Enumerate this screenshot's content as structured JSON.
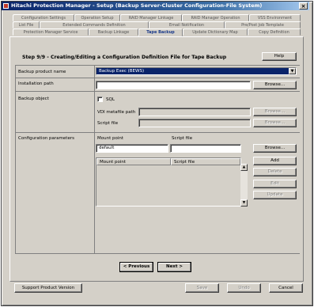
{
  "window": {
    "title": "Hitachi Protection Manager - Setup (Backup Server-Cluster Configuration-File System)"
  },
  "tabs_row1": [
    "Configuration Settings",
    "Operation Setup",
    "RAID Manager Linkage",
    "RAID Manager Operation",
    "VSS Environment"
  ],
  "tabs_row2": [
    "List File",
    "Extended Commands Definition",
    "Email Notification",
    "Pre/Post Job Template"
  ],
  "tabs_row3": [
    "Protection Manager Service",
    "Backup Linkage",
    "Tape Backup",
    "Update Dictionary Map",
    "Copy Definition"
  ],
  "active_tab": "Tape Backup",
  "step": {
    "title": "Step 9/9 - Creating/Editing a Configuration Definition File for Tape Backup",
    "help_label": "Help"
  },
  "form": {
    "backup_product_label": "Backup product name",
    "backup_product_value": "Backup Exec (BEWS)",
    "install_path_label": "Installation path",
    "install_path_value": "",
    "browse_label": "Browse...",
    "backup_object_label": "Backup object",
    "sql_label": "SQL",
    "vdi_label": "VDI metafile path",
    "script_file_label": "Script file",
    "config_params_label": "Configuration parameters",
    "mount_point_label": "Mount point",
    "script_file_col_label": "Script file",
    "mount_point_value": "default",
    "script_file_value": "",
    "table_headers": [
      "Mount point",
      "Script file"
    ],
    "add_label": "Add",
    "delete_label": "Delete",
    "edit_label": "Edit",
    "update_label": "Update"
  },
  "nav": {
    "previous_label": "< Previous",
    "next_label": "Next >"
  },
  "footer": {
    "support_label": "Support Product Version",
    "save_label": "Save",
    "undo_label": "Undo",
    "cancel_label": "Cancel"
  }
}
